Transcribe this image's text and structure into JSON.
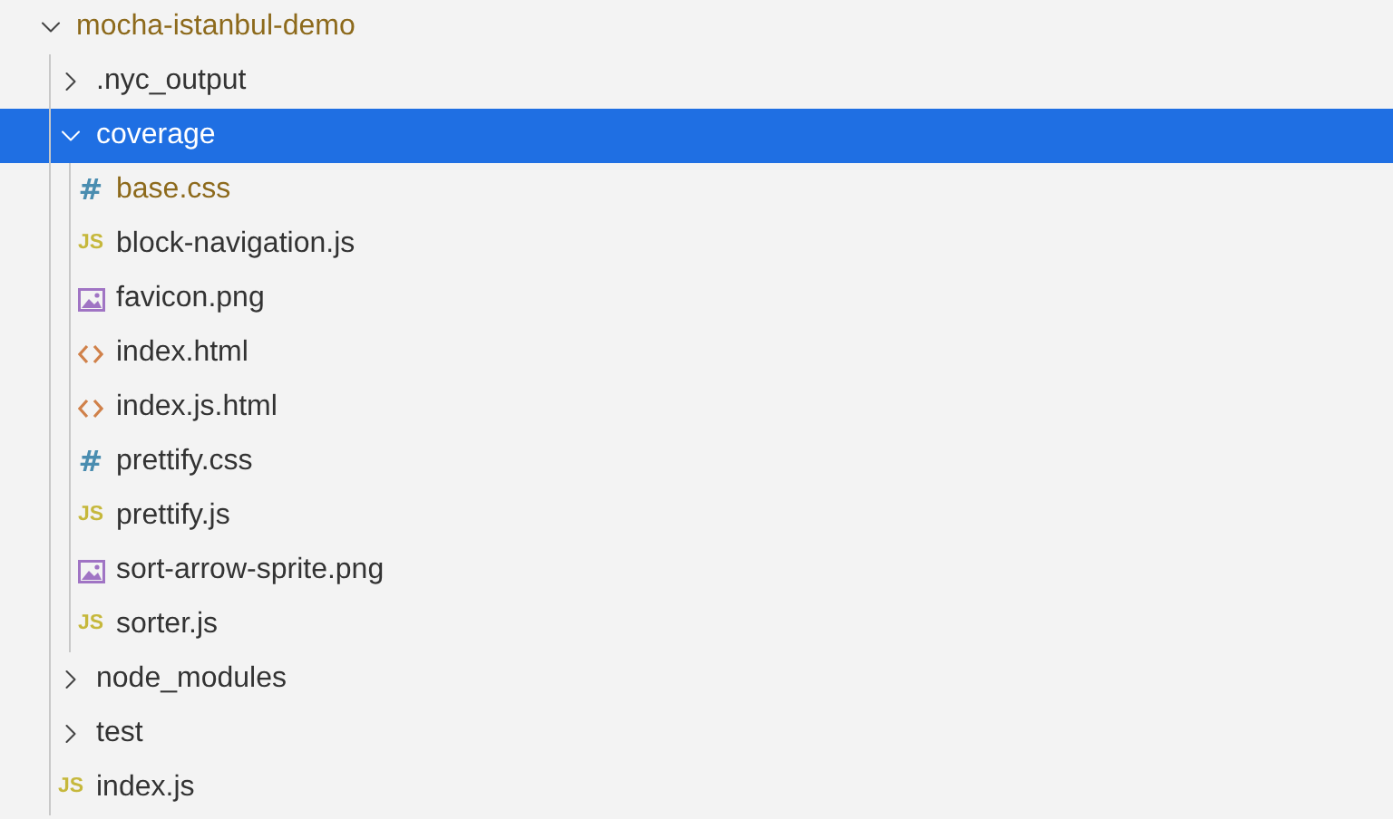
{
  "explorer": {
    "root": {
      "name": "mocha-istanbul-demo",
      "expanded": true,
      "modified": true,
      "selected": false,
      "children": [
        {
          "kind": "folder",
          "name": ".nyc_output",
          "expanded": false,
          "selected": false,
          "modified": false
        },
        {
          "kind": "folder",
          "name": "coverage",
          "expanded": true,
          "selected": true,
          "modified": false,
          "children": [
            {
              "kind": "css",
              "glyph": "#",
              "name": "base.css",
              "selected": false,
              "modified": true
            },
            {
              "kind": "js",
              "glyph": "JS",
              "name": "block-navigation.js",
              "selected": false,
              "modified": false
            },
            {
              "kind": "image",
              "name": "favicon.png",
              "selected": false,
              "modified": false
            },
            {
              "kind": "html",
              "name": "index.html",
              "selected": false,
              "modified": false
            },
            {
              "kind": "html",
              "name": "index.js.html",
              "selected": false,
              "modified": false
            },
            {
              "kind": "css",
              "glyph": "#",
              "name": "prettify.css",
              "selected": false,
              "modified": false
            },
            {
              "kind": "js",
              "glyph": "JS",
              "name": "prettify.js",
              "selected": false,
              "modified": false
            },
            {
              "kind": "image",
              "name": "sort-arrow-sprite.png",
              "selected": false,
              "modified": false
            },
            {
              "kind": "js",
              "glyph": "JS",
              "name": "sorter.js",
              "selected": false,
              "modified": false
            }
          ]
        },
        {
          "kind": "folder",
          "name": "node_modules",
          "expanded": false,
          "selected": false,
          "modified": false
        },
        {
          "kind": "folder",
          "name": "test",
          "expanded": false,
          "selected": false,
          "modified": false
        },
        {
          "kind": "js",
          "glyph": "JS",
          "name": "index.js",
          "selected": false,
          "modified": false
        }
      ]
    }
  }
}
